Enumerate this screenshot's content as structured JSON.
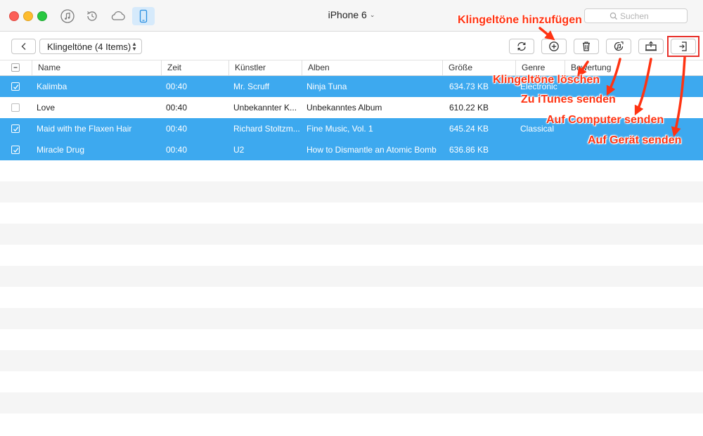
{
  "window": {
    "device_title": "iPhone 6",
    "search_placeholder": "Suchen",
    "nav_icons": [
      "music-icon",
      "restore-icon",
      "cloud-icon",
      "phone-icon"
    ]
  },
  "toolbar": {
    "category_label": "Klingeltöne (4 Items)",
    "tool_icons": [
      "refresh-icon",
      "add-icon",
      "trash-icon",
      "to-itunes-icon",
      "to-computer-icon",
      "to-device-icon"
    ]
  },
  "table": {
    "columns": [
      "Name",
      "Zeit",
      "Künstler",
      "Alben",
      "Größe",
      "Genre",
      "Bewertung"
    ],
    "rows": [
      {
        "name": "Kalimba",
        "time": "00:40",
        "artist": "Mr. Scruff",
        "album": "Ninja Tuna",
        "size": "634.73 KB",
        "genre": "Electronic",
        "selected": true
      },
      {
        "name": "Love",
        "time": "00:40",
        "artist": "Unbekannter K...",
        "album": "Unbekanntes Album",
        "size": "610.22 KB",
        "genre": "",
        "selected": false
      },
      {
        "name": "Maid with the Flaxen Hair",
        "time": "00:40",
        "artist": "Richard Stoltzm...",
        "album": "Fine Music, Vol. 1",
        "size": "645.24 KB",
        "genre": "Classical",
        "selected": true
      },
      {
        "name": "Miracle Drug",
        "time": "00:40",
        "artist": "U2",
        "album": "How to Dismantle an Atomic Bomb",
        "size": "636.86 KB",
        "genre": "",
        "selected": true
      }
    ]
  },
  "annotations": {
    "add": "Klingeltöne hinzufügen",
    "delete": "Klingeltöne löschen",
    "itunes": "Zu iTunes senden",
    "computer": "Auf Computer senden",
    "device": "Auf Gerät senden"
  },
  "colors": {
    "selection": "#3da9ef",
    "annotation": "#ff3312",
    "highlight_box": "#e8312b"
  }
}
